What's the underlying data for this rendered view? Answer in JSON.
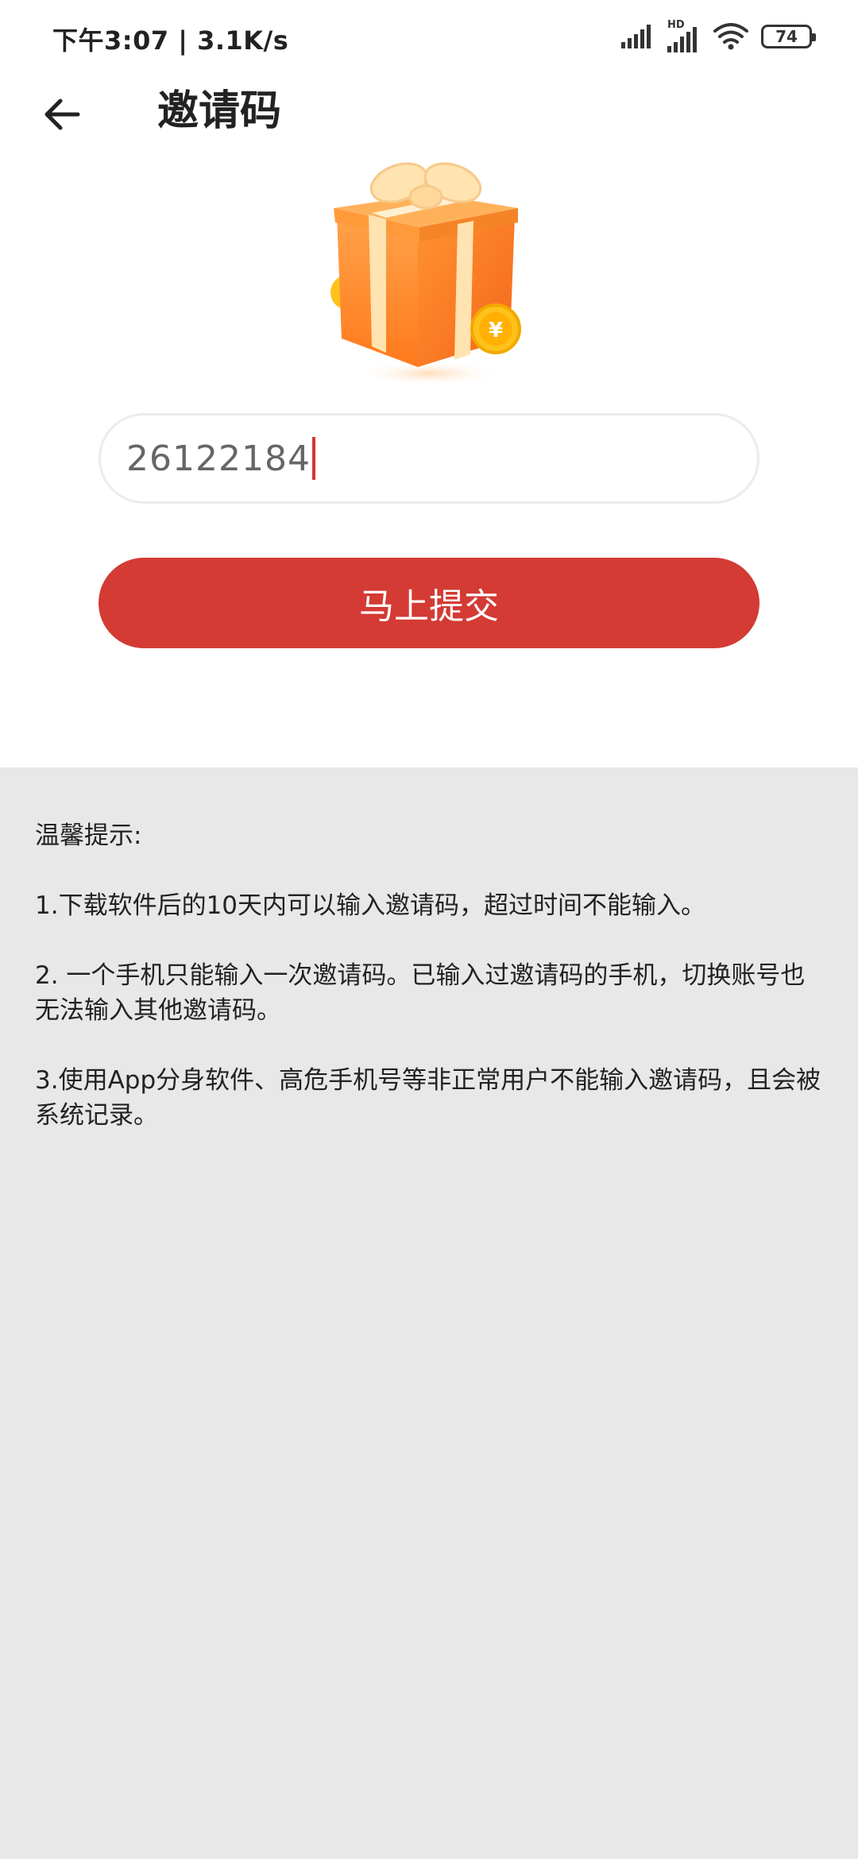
{
  "status_bar": {
    "time": "下午3:07 | 3.1K/s",
    "signal_label": "HD",
    "battery": "74",
    "icons": [
      "signal-icon",
      "hd-signal-icon",
      "wifi-icon",
      "battery-icon"
    ]
  },
  "app_bar": {
    "title": "邀请码",
    "back_icon": "arrow-left-icon"
  },
  "illustration": {
    "icon": "gift-box-icon",
    "coin_symbol": "¥"
  },
  "form": {
    "invite_code_value": "26122184",
    "submit_label": "马上提交"
  },
  "tips": {
    "heading": "温馨提示:",
    "items": [
      "1.下载软件后的10天内可以输入邀请码，超过时间不能输入。",
      "2. 一个手机只能输入一次邀请码。已输入过邀请码的手机，切换账号也无法输入其他邀请码。",
      "3.使用App分身软件、高危手机号等非正常用户不能输入邀请码，且会被系统记录。"
    ]
  },
  "colors": {
    "accent": "#d33b34",
    "background": "#e8e8e8",
    "card": "#ffffff",
    "gift_orange": "#ff8a2a",
    "ribbon": "#ffe3b0",
    "coin": "#ffc21a"
  }
}
